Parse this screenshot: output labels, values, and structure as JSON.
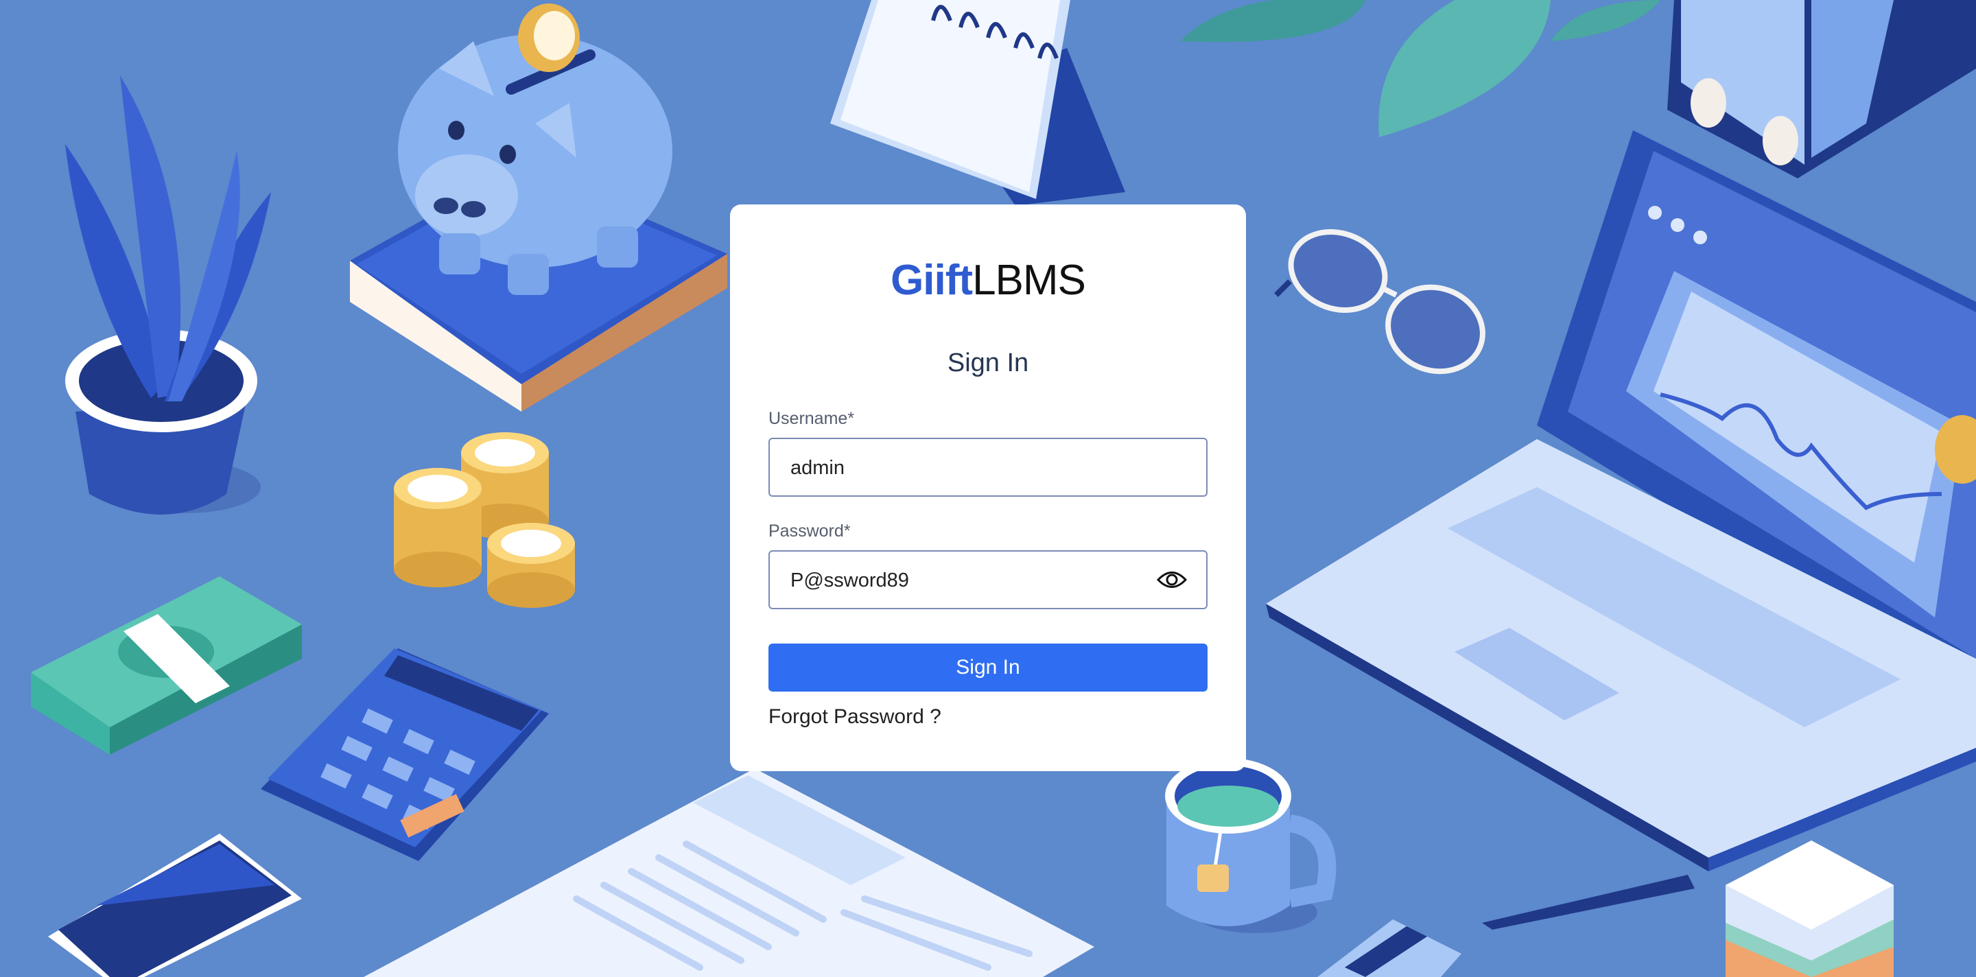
{
  "brand": {
    "part1": "Giift",
    "part2": "LBMS"
  },
  "form": {
    "title": "Sign In",
    "username_label": "Username*",
    "username_value": "admin",
    "password_label": "Password*",
    "password_value": "P@ssword89",
    "submit_label": "Sign In",
    "forgot_label": "Forgot Password ?"
  },
  "icons": {
    "password_toggle": "eye-icon"
  },
  "colors": {
    "background": "#5d89cd",
    "brand_accent": "#2f5bd1",
    "button": "#2f6ef2"
  }
}
